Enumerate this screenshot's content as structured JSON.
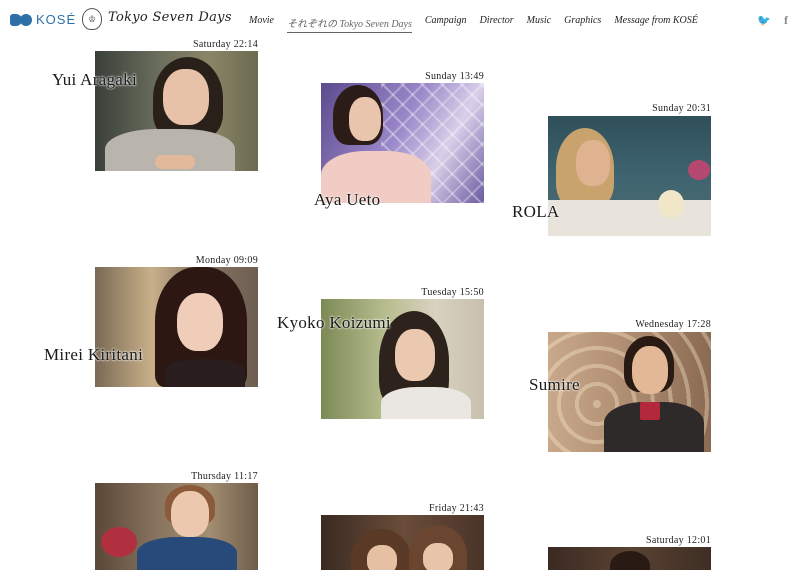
{
  "header": {
    "brand": "KOSÉ",
    "crest": "♔",
    "campaign_logo": "Tokyo Seven Days",
    "nav": [
      {
        "label": "Movie"
      },
      {
        "label": "それぞれの Tokyo Seven Days",
        "active": true
      },
      {
        "label": "Campaign"
      },
      {
        "label": "Director"
      },
      {
        "label": "Music"
      },
      {
        "label": "Graphics"
      },
      {
        "label": "Message from KOSÉ"
      }
    ],
    "social": [
      "twitter-icon",
      "facebook-icon"
    ],
    "twitter_glyph": "🐦",
    "facebook_glyph": "f"
  },
  "cards": [
    {
      "time": "Saturday 22:14",
      "name": "Yui Aragaki"
    },
    {
      "time": "Sunday 13:49",
      "name": "Aya Ueto"
    },
    {
      "time": "Sunday 20:31",
      "name": "ROLA"
    },
    {
      "time": "Monday 09:09",
      "name": "Mirei Kiritani"
    },
    {
      "time": "Tuesday 15:50",
      "name": "Kyoko Koizumi"
    },
    {
      "time": "Wednesday 17:28",
      "name": "Sumire"
    },
    {
      "time": "Thursday 11:17",
      "name": ""
    },
    {
      "time": "Friday 21:43",
      "name": ""
    },
    {
      "time": "Saturday 12:01",
      "name": ""
    }
  ],
  "colors": {
    "brand_blue": "#2f6fa8",
    "text": "#222222",
    "background": "#ffffff"
  }
}
